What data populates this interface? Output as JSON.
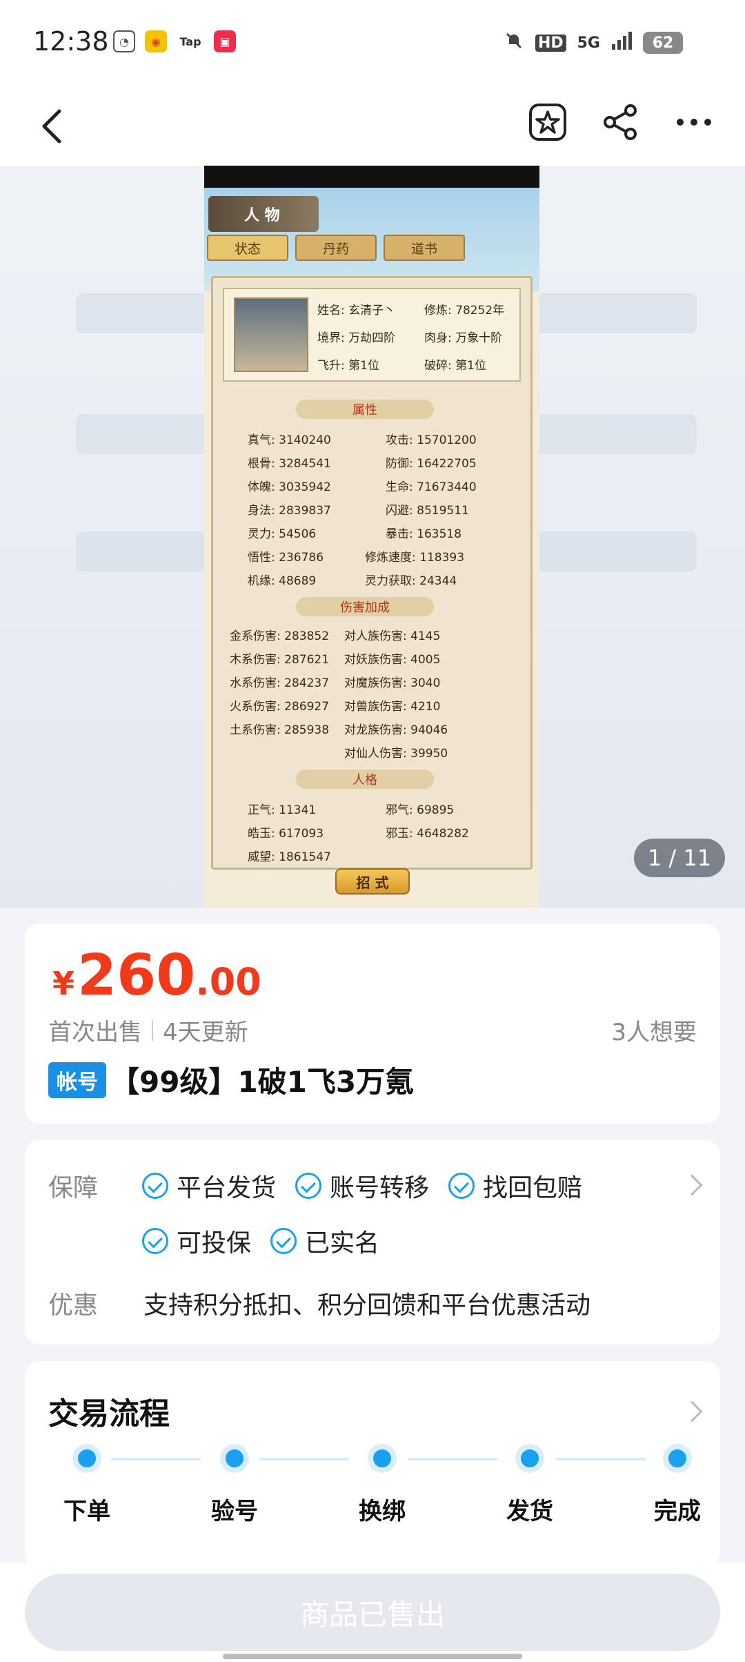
{
  "status_bar": {
    "time": "12:38",
    "network": "5G",
    "battery": "62",
    "hd": "HD",
    "tap": "Tap"
  },
  "gallery": {
    "counter": "1 / 11",
    "game": {
      "header": "人 物",
      "tabs": [
        "状态",
        "丹药",
        "道书"
      ],
      "profile": {
        "name": "姓名: 玄清子丶",
        "cultivation": "修炼: 78252年",
        "realm": "境界: 万劫四阶",
        "body": "肉身: 万象十阶",
        "ascend": "飞升: 第1位",
        "break": "破碎: 第1位"
      },
      "attr_title": "属性",
      "attrs": [
        [
          "真气: 3140240",
          "攻击: 15701200"
        ],
        [
          "根骨: 3284541",
          "防御: 16422705"
        ],
        [
          "体魄: 3035942",
          "生命: 71673440"
        ],
        [
          "身法: 2839837",
          "闪避: 8519511"
        ],
        [
          "灵力: 54506",
          "暴击: 163518"
        ],
        [
          "悟性: 236786",
          "修炼速度: 118393"
        ],
        [
          "机缘: 48689",
          "灵力获取: 24344"
        ]
      ],
      "dmg_title": "伤害加成",
      "dmg": [
        [
          "金系伤害: 283852",
          "对人族伤害: 4145"
        ],
        [
          "木系伤害: 287621",
          "对妖族伤害: 4005"
        ],
        [
          "水系伤害: 284237",
          "对魔族伤害: 3040"
        ],
        [
          "火系伤害: 286927",
          "对兽族伤害: 4210"
        ],
        [
          "土系伤害: 285938",
          "对龙族伤害: 94046"
        ],
        [
          "",
          "对仙人伤害: 39950"
        ]
      ],
      "person_title": "人格",
      "person": [
        [
          "正气: 11341",
          "邪气: 69895"
        ],
        [
          "皓玉: 617093",
          "邪玉: 4648282"
        ],
        [
          "威望: 1861547",
          ""
        ]
      ],
      "button": "招 式"
    }
  },
  "price": {
    "currency": "¥",
    "integer": "260",
    "decimal": ".00"
  },
  "meta": {
    "first_sale": "首次出售",
    "updated": "4天更新",
    "wants": "3人想要"
  },
  "item": {
    "tag": "帐号",
    "title": "【99级】1破1飞3万氪"
  },
  "guarantee": {
    "label": "保障",
    "items_row1": [
      "平台发货",
      "账号转移",
      "找回包赔"
    ],
    "items_row2": [
      "可投保",
      "已实名"
    ],
    "promo_label": "优惠",
    "promo_text": "支持积分抵扣、积分回馈和平台优惠活动"
  },
  "flow": {
    "title": "交易流程",
    "steps": [
      "下单",
      "验号",
      "换绑",
      "发货",
      "完成"
    ]
  },
  "bottom": {
    "button": "商品已售出"
  },
  "colors": {
    "price": "#f03a1a",
    "accent": "#1aa0f0",
    "tag": "#1a8fe6"
  }
}
